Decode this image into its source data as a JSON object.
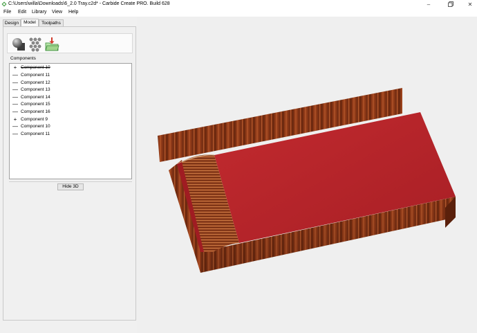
{
  "window": {
    "title": "C:\\Users\\willa\\Downloads\\6_2.0 Tray.c2d* - Carbide Create PRO. Build 628",
    "minimize_icon": "minimize-icon",
    "maximize_icon": "maximize-icon",
    "close_icon": "close-icon"
  },
  "menu": {
    "items": [
      "File",
      "Edit",
      "Library",
      "View",
      "Help"
    ]
  },
  "tabs": [
    "Design",
    "Model",
    "Toolpaths"
  ],
  "active_tab": "Model",
  "toolbar": {
    "icons": [
      "sphere-box-icon",
      "grid-pattern-icon",
      "import-model-icon"
    ]
  },
  "components": {
    "label": "Components",
    "items": [
      {
        "name": "Component 10",
        "glyph": "+",
        "struck": true
      },
      {
        "name": "Component 11",
        "glyph": "—",
        "struck": false
      },
      {
        "name": "Component 12",
        "glyph": "—",
        "struck": false
      },
      {
        "name": "Component 13",
        "glyph": "—",
        "struck": false
      },
      {
        "name": "Component 14",
        "glyph": "—",
        "struck": false
      },
      {
        "name": "Component 15",
        "glyph": "—",
        "struck": false
      },
      {
        "name": "Component 16",
        "glyph": "—",
        "struck": false
      },
      {
        "name": "Component 9",
        "glyph": "+",
        "struck": false
      },
      {
        "name": "Component 10",
        "glyph": "—",
        "struck": false
      },
      {
        "name": "Component 11",
        "glyph": "—",
        "struck": false
      }
    ]
  },
  "hide3d_label": "Hide 3D",
  "colors": {
    "top_face": "#b8232a",
    "wood_dark": "#6e2a10",
    "wood_light": "#a84d24"
  }
}
